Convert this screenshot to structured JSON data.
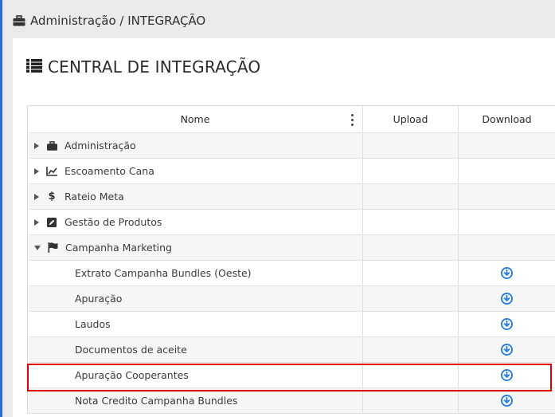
{
  "breadcrumb": {
    "text": "Administração / INTEGRAÇÃO",
    "icon": "briefcase-icon"
  },
  "page": {
    "title": "CENTRAL DE INTEGRAÇÃO",
    "icon": "list-icon"
  },
  "table": {
    "columns": [
      "Nome",
      "Upload",
      "Download"
    ],
    "groups": [
      {
        "label": "Administração",
        "icon": "briefcase-icon",
        "expanded": false
      },
      {
        "label": "Escoamento Cana",
        "icon": "line-chart-icon",
        "expanded": false
      },
      {
        "label": "Rateio Meta",
        "icon": "dollar-icon",
        "expanded": false
      },
      {
        "label": "Gestão de Produtos",
        "icon": "edit-icon",
        "expanded": false
      },
      {
        "label": "Campanha Marketing",
        "icon": "flag-icon",
        "expanded": true
      }
    ],
    "children": [
      {
        "label": "Extrato Campanha Bundles (Oeste)",
        "download": "download-icon"
      },
      {
        "label": "Apuração",
        "download": "download-icon"
      },
      {
        "label": "Laudos",
        "download": "download-icon"
      },
      {
        "label": "Documentos de aceite",
        "download": "download-icon"
      },
      {
        "label": "Apuração Cooperantes",
        "download": "download-icon"
      },
      {
        "label": "Nota Credito Campanha Bundles",
        "download": "download-icon"
      }
    ]
  },
  "colors": {
    "download_icon": "#2a7be4",
    "highlight_border": "#e00000",
    "left_accent": "#2a6bd8"
  }
}
